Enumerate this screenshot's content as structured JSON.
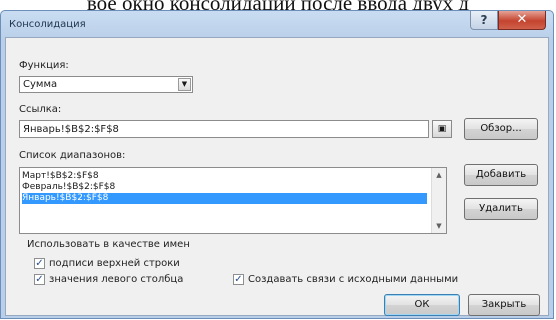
{
  "caption": "вое окно консолидации после ввода двух д",
  "window": {
    "title": "Консолидация",
    "help_label": "?",
    "close_label": "✕"
  },
  "function": {
    "label": "Функция:",
    "selected": "Сумма"
  },
  "reference": {
    "label": "Ссылка:",
    "value": "Январь!$B$2:$F$8",
    "browse_label": "Обзор..."
  },
  "ranges": {
    "label": "Список диапазонов:",
    "items": [
      "Март!$B$2:$F$8",
      "Февраль!$B$2:$F$8",
      "Январь!$B$2:$F$8"
    ],
    "selected_index": 2,
    "add_label": "Добавить",
    "delete_label": "Удалить"
  },
  "use_labels": {
    "label": "Использовать в качестве имен",
    "top_row": {
      "label": "подписи верхней строки",
      "checked": true
    },
    "left_column": {
      "label": "значения левого столбца",
      "checked": true
    }
  },
  "create_links": {
    "label": "Создавать связи с исходными данными",
    "checked": true
  },
  "buttons": {
    "ok": "ОК",
    "close": "Закрыть"
  },
  "colors": {
    "selection": "#3399ff",
    "title_gradient": "#c9dcf1",
    "close_button": "#c4442f"
  },
  "icons": {
    "collapse": "range-select-icon",
    "dropdown": "chevron-down-icon",
    "scroll_up": "scroll-up-icon",
    "scroll_down": "scroll-down-icon"
  }
}
